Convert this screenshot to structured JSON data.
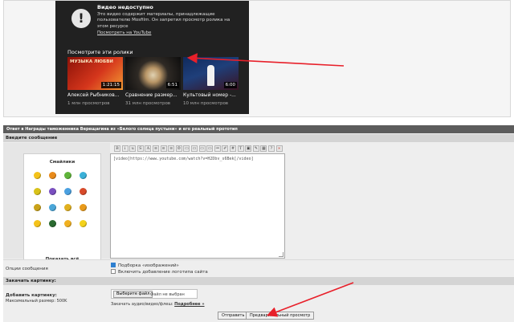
{
  "player": {
    "unavailable_title": "Видео недоступно",
    "unavailable_message": "Это видео содержит материалы, принадлежащие пользователю Mosfilm. Он запретил просмотр ролика на этом ресурсе",
    "youtube_link": "Посмотреть на YouTube",
    "watch_these": "Посмотрите эти ролики",
    "videos": [
      {
        "thumb_text": "МУЗЫКА ЛЮБВИ",
        "duration": "1:21:15",
        "title": "Алексей Рыбников...",
        "views": "1 млн просмотров"
      },
      {
        "thumb_text": "",
        "duration": "6:51",
        "title": "Сравнение размер...",
        "views": "31 млн просмотров"
      },
      {
        "thumb_text": "",
        "duration": "6:00",
        "title": "Культовый номер -...",
        "views": "10 млн просмотров"
      }
    ]
  },
  "form": {
    "title": "Ответ в Награды таможенника Верещагина из «Белого солнца пустыни» и его реальный прототип",
    "section_message": "Введите сообщение",
    "smiles_title": "Смайлики",
    "show_all": "Показать всё",
    "toolbar": [
      "B",
      "i",
      "u",
      "S",
      "A",
      "≡",
      "≡",
      "≡",
      "☺",
      "▭",
      "▭",
      "▭",
      "▭",
      "≔",
      "✐",
      "#",
      "T",
      "▣",
      "✎",
      "▦",
      "?",
      "×"
    ],
    "message_text": "[video]https://www.youtube.com/watch?v=H2Dbv_s6Bek[/video]",
    "options_label": "Опции сообщения",
    "option_1": "Подборка «изображений»",
    "option_2": "Включить добавление логотипа сайта",
    "section_image": "Закачать картинку:",
    "attach_label": "Добавить картинку:",
    "attach_size": "Максимальный размер: 500K",
    "choose_file": "Выберите файл",
    "no_file": "Файл не выбран",
    "upload_text": "Закачать аудио/видео/флеш:",
    "upload_more": "Подробнее »",
    "send_button": "Отправить",
    "preview_button": "Предварительный просмотр"
  },
  "colors": {
    "arrow": "#e8202a",
    "player_bg": "#212121",
    "form_header": "#5c5c5c"
  },
  "smile_colors": [
    "#f4c21a",
    "#e88a1a",
    "#5fb33a",
    "#3ab0d8",
    "#d8c21a",
    "#7a4fc0",
    "#4aa0e0",
    "#d84a2a",
    "#c9a21a",
    "#4aa6d8",
    "#e0b020",
    "#e89a1a",
    "#f4c21a",
    "#2a6a30",
    "#f0b020",
    "#f4d21a"
  ]
}
